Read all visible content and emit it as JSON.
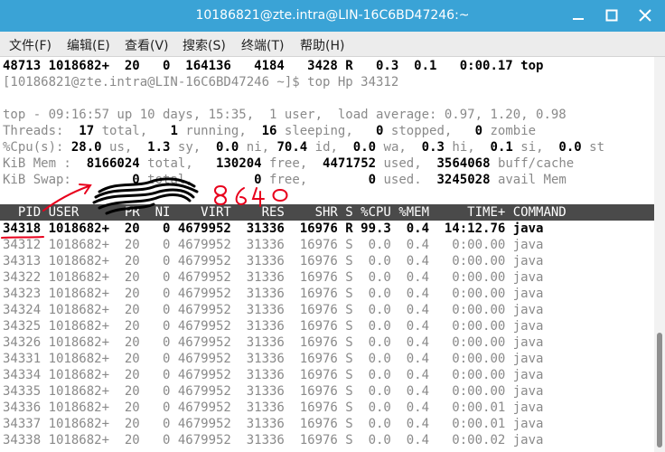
{
  "window": {
    "title": "10186821@zte.intra@LIN-16C6BD47246:~"
  },
  "menu": [
    {
      "label": "文件(F)"
    },
    {
      "label": "编辑(E)"
    },
    {
      "label": "查看(V)"
    },
    {
      "label": "搜索(S)"
    },
    {
      "label": "终端(T)"
    },
    {
      "label": "帮助(H)"
    }
  ],
  "terminal": {
    "prev_line": "48713 1018682+  20   0  164136   4184   3428 R   0.3  0.1   0:00.17 top",
    "prompt": "[10186821@zte.intra@LIN-16C6BD47246 ~]$ top Hp 34312",
    "summary": {
      "line1": "top - 09:16:57 up 10 days, 15:35,  1 user,  load average: 0.97, 1.20, 0.98",
      "threads": {
        "label": "Threads:",
        "total": "17",
        "running": "1",
        "sleeping": "16",
        "stopped": "0",
        "zombie": "0"
      },
      "cpu": {
        "label": "%Cpu(s):",
        "us": "28.0",
        "sy": "1.3",
        "ni": "0.0",
        "id": "70.4",
        "wa": "0.0",
        "hi": "0.3",
        "si": "0.1",
        "st": "0.0"
      },
      "mem": {
        "label": "KiB Mem :",
        "total": "8166024",
        "free": "130204",
        "used": "4471752",
        "buff_cache": "3564068"
      },
      "swap": {
        "label": "KiB Swap:",
        "total": "0",
        "free": "0",
        "used": "0",
        "avail_mem": "3245028"
      }
    },
    "columns": [
      "PID",
      "USER",
      "PR",
      "NI",
      "VIRT",
      "RES",
      "SHR",
      "S",
      "%CPU",
      "%MEM",
      "TIME+",
      "COMMAND"
    ],
    "header_line": "  PID USER      PR  NI    VIRT    RES    SHR S %CPU %MEM     TIME+ COMMAND",
    "rows": [
      {
        "pid": "34318",
        "user": "1018682+",
        "pr": "20",
        "ni": "0",
        "virt": "4679952",
        "res": "31336",
        "shr": "16976",
        "s": "R",
        "cpu": "99.3",
        "mem": "0.4",
        "time": "14:12.76",
        "cmd": "java",
        "highlight": true
      },
      {
        "pid": "34312",
        "user": "1018682+",
        "pr": "20",
        "ni": "0",
        "virt": "4679952",
        "res": "31336",
        "shr": "16976",
        "s": "S",
        "cpu": "0.0",
        "mem": "0.4",
        "time": "0:00.00",
        "cmd": "java"
      },
      {
        "pid": "34313",
        "user": "1018682+",
        "pr": "20",
        "ni": "0",
        "virt": "4679952",
        "res": "31336",
        "shr": "16976",
        "s": "S",
        "cpu": "0.0",
        "mem": "0.4",
        "time": "0:00.00",
        "cmd": "java"
      },
      {
        "pid": "34322",
        "user": "1018682+",
        "pr": "20",
        "ni": "0",
        "virt": "4679952",
        "res": "31336",
        "shr": "16976",
        "s": "S",
        "cpu": "0.0",
        "mem": "0.4",
        "time": "0:00.00",
        "cmd": "java"
      },
      {
        "pid": "34323",
        "user": "1018682+",
        "pr": "20",
        "ni": "0",
        "virt": "4679952",
        "res": "31336",
        "shr": "16976",
        "s": "S",
        "cpu": "0.0",
        "mem": "0.4",
        "time": "0:00.00",
        "cmd": "java"
      },
      {
        "pid": "34324",
        "user": "1018682+",
        "pr": "20",
        "ni": "0",
        "virt": "4679952",
        "res": "31336",
        "shr": "16976",
        "s": "S",
        "cpu": "0.0",
        "mem": "0.4",
        "time": "0:00.00",
        "cmd": "java"
      },
      {
        "pid": "34325",
        "user": "1018682+",
        "pr": "20",
        "ni": "0",
        "virt": "4679952",
        "res": "31336",
        "shr": "16976",
        "s": "S",
        "cpu": "0.0",
        "mem": "0.4",
        "time": "0:00.00",
        "cmd": "java"
      },
      {
        "pid": "34326",
        "user": "1018682+",
        "pr": "20",
        "ni": "0",
        "virt": "4679952",
        "res": "31336",
        "shr": "16976",
        "s": "S",
        "cpu": "0.0",
        "mem": "0.4",
        "time": "0:00.00",
        "cmd": "java"
      },
      {
        "pid": "34331",
        "user": "1018682+",
        "pr": "20",
        "ni": "0",
        "virt": "4679952",
        "res": "31336",
        "shr": "16976",
        "s": "S",
        "cpu": "0.0",
        "mem": "0.4",
        "time": "0:00.00",
        "cmd": "java"
      },
      {
        "pid": "34334",
        "user": "1018682+",
        "pr": "20",
        "ni": "0",
        "virt": "4679952",
        "res": "31336",
        "shr": "16976",
        "s": "S",
        "cpu": "0.0",
        "mem": "0.4",
        "time": "0:00.00",
        "cmd": "java"
      },
      {
        "pid": "34335",
        "user": "1018682+",
        "pr": "20",
        "ni": "0",
        "virt": "4679952",
        "res": "31336",
        "shr": "16976",
        "s": "S",
        "cpu": "0.0",
        "mem": "0.4",
        "time": "0:00.00",
        "cmd": "java"
      },
      {
        "pid": "34336",
        "user": "1018682+",
        "pr": "20",
        "ni": "0",
        "virt": "4679952",
        "res": "31336",
        "shr": "16976",
        "s": "S",
        "cpu": "0.0",
        "mem": "0.4",
        "time": "0:00.01",
        "cmd": "java"
      },
      {
        "pid": "34337",
        "user": "1018682+",
        "pr": "20",
        "ni": "0",
        "virt": "4679952",
        "res": "31336",
        "shr": "16976",
        "s": "S",
        "cpu": "0.0",
        "mem": "0.4",
        "time": "0:00.01",
        "cmd": "java"
      },
      {
        "pid": "34338",
        "user": "1018682+",
        "pr": "20",
        "ni": "0",
        "virt": "4679952",
        "res": "31336",
        "shr": "16976",
        "s": "S",
        "cpu": "0.0",
        "mem": "0.4",
        "time": "0:00.02",
        "cmd": "java"
      }
    ]
  },
  "annotation": {
    "handwritten_text": "8640"
  },
  "colors": {
    "titlebar": "#3aa3d6",
    "header_row": "#4a4a4a",
    "annotation": "#e8001c"
  }
}
